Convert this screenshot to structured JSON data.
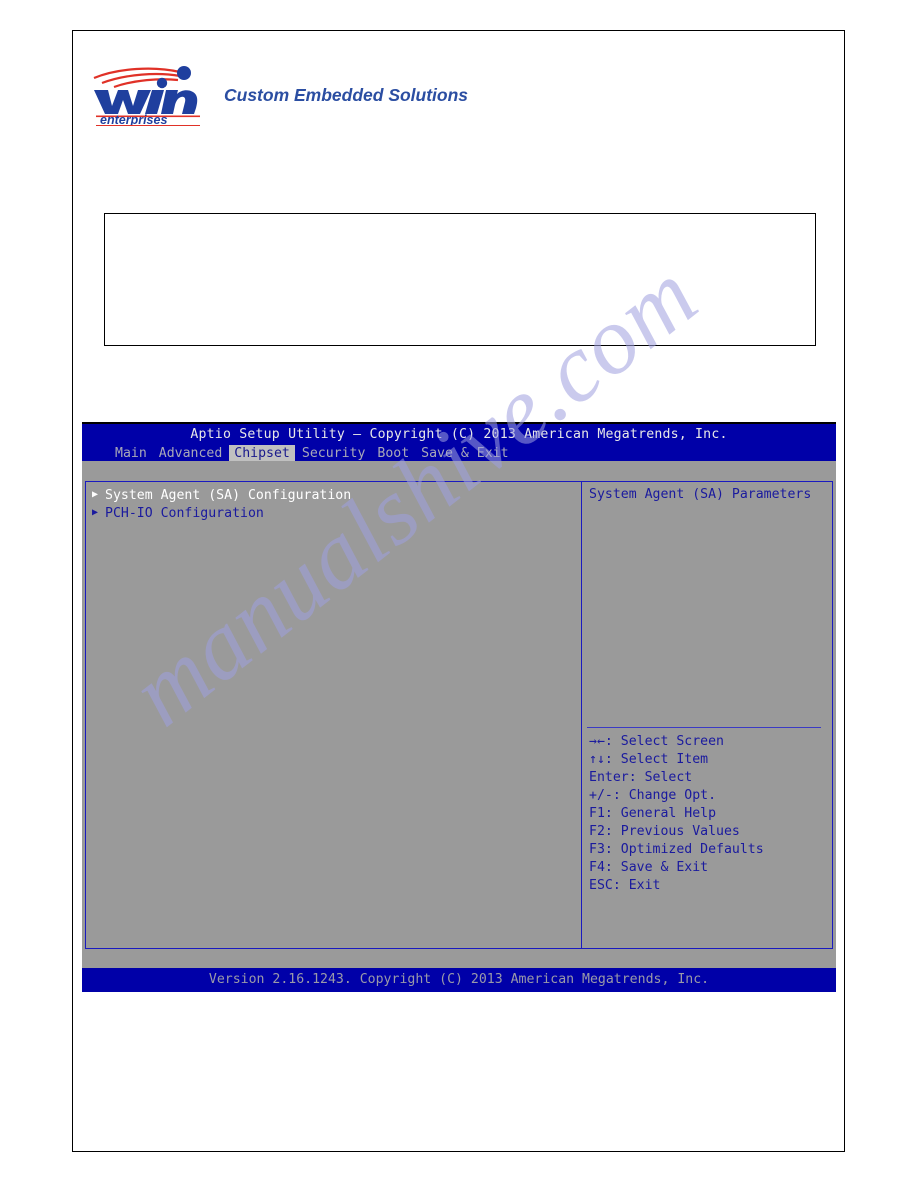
{
  "letterhead": {
    "logo_word": "win",
    "logo_sub": "enterprises",
    "tagline": "Custom Embedded Solutions"
  },
  "watermark": {
    "text": "manualshive.com"
  },
  "bios": {
    "title": "Aptio Setup Utility – Copyright (C) 2013 American Megatrends, Inc.",
    "menu_tabs": [
      {
        "label": "Main",
        "active": false
      },
      {
        "label": "Advanced",
        "active": false
      },
      {
        "label": "Chipset",
        "active": true
      },
      {
        "label": "Security",
        "active": false
      },
      {
        "label": "Boot",
        "active": false
      },
      {
        "label": "Save & Exit",
        "active": false
      }
    ],
    "items": [
      {
        "arrow": "▶",
        "label": "System Agent (SA) Configuration",
        "selected": true
      },
      {
        "arrow": "▶",
        "label": "PCH-IO Configuration",
        "selected": false
      }
    ],
    "help_text": "System Agent (SA) Parameters",
    "key_legend": [
      "→←: Select Screen",
      "↑↓: Select Item",
      "Enter: Select",
      "+/-: Change Opt.",
      "F1: General Help",
      "F2: Previous Values",
      "F3: Optimized Defaults",
      "F4: Save & Exit",
      "ESC: Exit"
    ],
    "footer": "Version 2.16.1243. Copyright (C) 2013 American Megatrends, Inc."
  },
  "colors": {
    "bios_blue": "#0000a8",
    "bios_gray": "#9a9a9a",
    "border_blue": "#1a1ac0",
    "text_blue": "#1a1a9e",
    "active_tab_bg": "#c0c0c0",
    "logo_blue": "#1f3f9e",
    "logo_red": "#e03127",
    "tagline_blue": "#2b4ea2",
    "watermark": "#9fa0e0"
  }
}
